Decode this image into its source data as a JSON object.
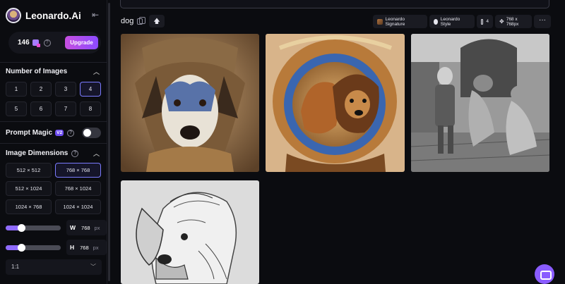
{
  "app": {
    "brand": "Leonardo.Ai"
  },
  "credits": {
    "count": "146",
    "upgrade_label": "Upgrade"
  },
  "number_of_images": {
    "title": "Number of Images",
    "options": [
      "1",
      "2",
      "3",
      "4",
      "5",
      "6",
      "7",
      "8"
    ],
    "selected": "4"
  },
  "prompt_magic": {
    "title": "Prompt Magic",
    "version_badge": "V2"
  },
  "image_dimensions": {
    "title": "Image Dimensions",
    "options": [
      "512 × 512",
      "768 × 768",
      "512 × 1024",
      "768 × 1024",
      "1024 × 768",
      "1024 × 1024"
    ],
    "selected": "768 × 768",
    "width": {
      "label": "W",
      "value": "768",
      "unit": "px",
      "slider_fraction": 0.25
    },
    "height": {
      "label": "H",
      "value": "768",
      "unit": "px",
      "slider_fraction": 0.25
    },
    "aspect_ratio": "1:1"
  },
  "generation": {
    "prompt": "dog",
    "chips": {
      "model": "Leonardo Signature",
      "style": "Leonardo Style",
      "count": "4",
      "size": "768 x 768px"
    },
    "more_label": "···"
  },
  "colors": {
    "accent": "#8c4bff",
    "selected_border": "#7b7bff",
    "toggle_off": "#35363f"
  }
}
